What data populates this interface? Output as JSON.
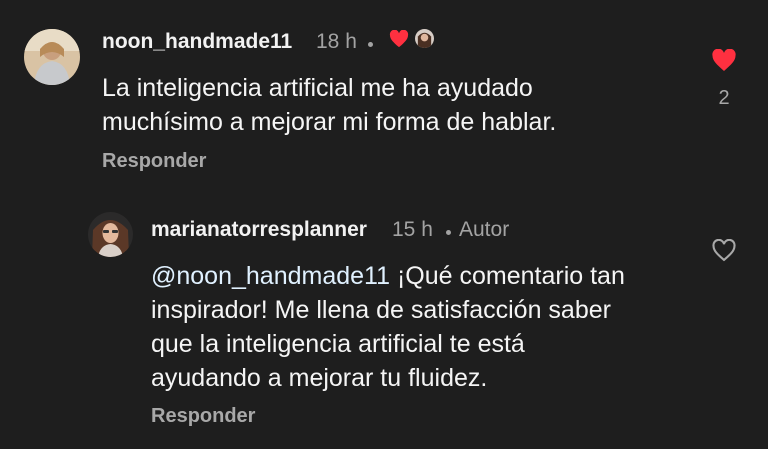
{
  "colors": {
    "background": "#1e1e1e",
    "heart_red": "#ff3040",
    "secondary_text": "#a3a3a3"
  },
  "comment": {
    "username": "noon_handmade11",
    "time": "18 h",
    "text_line1": "La inteligencia artificial me ha ayudado",
    "text_line2": "muchísimo a mejorar mi forma de hablar.",
    "reply_label": "Responder",
    "like_count": "2",
    "like_icon": "heart-filled-icon",
    "liked_by_author_icon": "heart-filled-icon"
  },
  "reply": {
    "username": "marianatorresplanner",
    "time": "15 h",
    "author_badge": "Autor",
    "mention": "@noon_handmade11",
    "text_line1_rest": " ¡Qué comentario tan",
    "text_line2": "inspirador! Me llena de satisfacción saber",
    "text_line3": "que la inteligencia artificial te está",
    "text_line4": "ayudando a mejorar tu fluidez.",
    "reply_label": "Responder",
    "like_icon": "heart-outline-icon"
  }
}
